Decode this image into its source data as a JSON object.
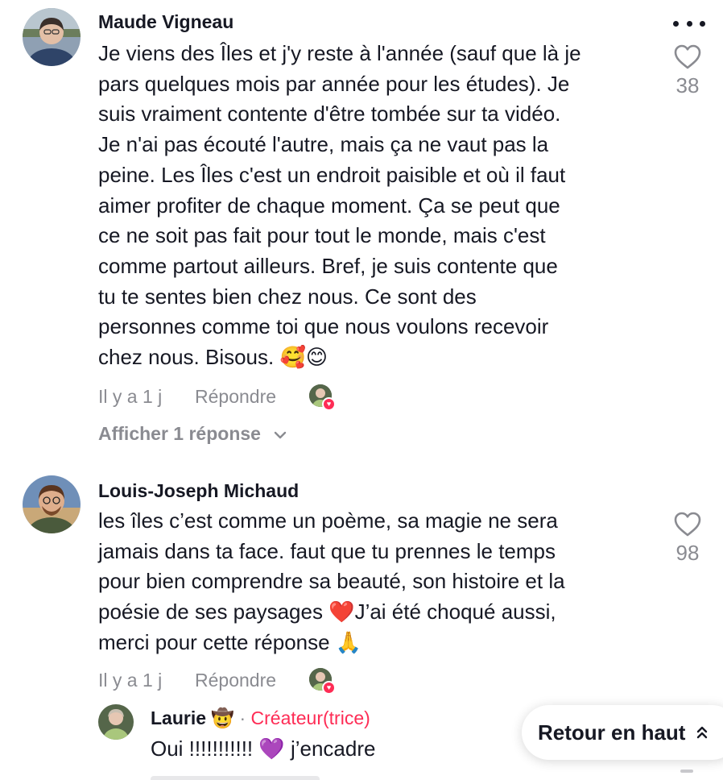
{
  "comments": [
    {
      "author": "Maude Vigneau",
      "text": "Je viens des Îles et j'y reste à l'année (sauf que là je\npars quelques mois par année pour les études). Je\nsuis vraiment contente d'être tombée sur ta vidéo.\nJe n'ai pas écouté l'autre, mais ça ne vaut pas la\npeine. Les Îles c'est un endroit paisible et où il faut\naimer profiter de chaque moment. Ça se peut que\nce ne soit pas fait pour tout le monde, mais c'est\ncomme partout ailleurs. Bref, je suis contente que\ntu te sentes bien chez nous. Ce sont des\npersonnes comme toi que nous voulons recevoir\nchez nous. Bisous. 🥰😊",
      "time": "Il y a 1 j",
      "reply_label": "Répondre",
      "likes": "38",
      "view_replies": "Afficher 1 réponse"
    },
    {
      "author": "Louis-Joseph Michaud",
      "text": "les îles c’est comme un poème, sa magie ne sera\njamais dans ta face. faut que tu prennes le temps\npour bien comprendre sa beauté, son histoire et la\npoésie de ses paysages ❤️J’ai été choqué aussi,\nmerci pour cette réponse 🙏",
      "time": "Il y a 1 j",
      "reply_label": "Répondre",
      "likes": "98"
    }
  ],
  "reply": {
    "author": "Laurie",
    "author_emoji": "🤠",
    "separator": "·",
    "creator_badge": "Créateur(trice)",
    "text": "Oui !!!!!!!!!!! 💜 j’encadre"
  },
  "back_to_top": {
    "label": "Retour en haut",
    "icon": "double-chevron-up-icon"
  },
  "colors": {
    "text": "#161823",
    "muted": "#8a8b91",
    "accent": "#fe2c55"
  }
}
